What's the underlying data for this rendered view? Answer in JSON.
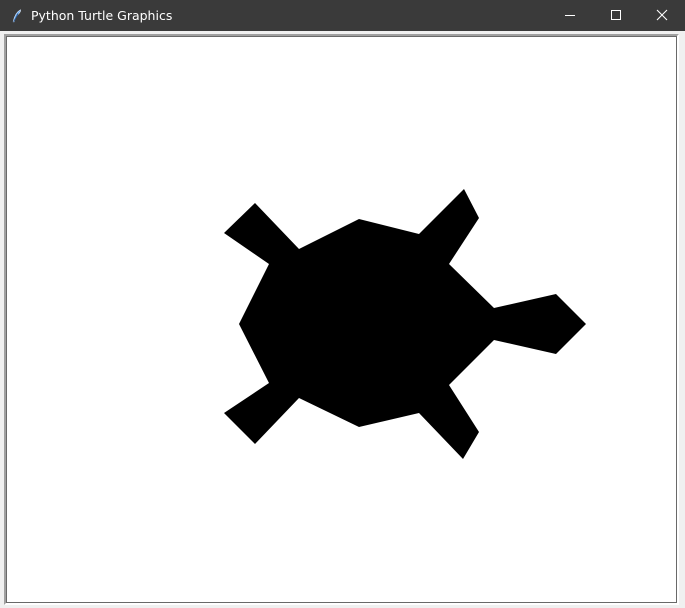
{
  "window": {
    "title": "Python Turtle Graphics",
    "app_icon": "feather-icon",
    "controls": {
      "minimize_icon": "minimize-icon",
      "maximize_icon": "maximize-icon",
      "close_icon": "close-icon"
    }
  },
  "canvas": {
    "background": "#ffffff",
    "turtle": {
      "shape": "turtle",
      "fill": "#000000",
      "heading": "east"
    }
  }
}
